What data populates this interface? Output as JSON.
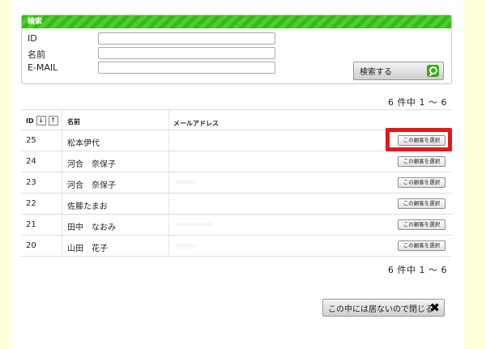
{
  "search": {
    "header": "検索",
    "fields": [
      {
        "label": "ID",
        "value": ""
      },
      {
        "label": "名前",
        "value": ""
      },
      {
        "label": "E-MAIL",
        "value": ""
      }
    ],
    "button_label": "検索する",
    "button_icon": "search-icon"
  },
  "result_count": "6 件中 1 〜 6",
  "table": {
    "headers": {
      "id": "ID",
      "name": "名前",
      "email": "メールアドレス"
    },
    "sort_asc": "↓",
    "sort_desc": "↑",
    "select_label": "この顧客を選択",
    "rows": [
      {
        "id": "25",
        "name": "松本伊代",
        "email": ""
      },
      {
        "id": "24",
        "name": "河合　奈保子",
        "email": ""
      },
      {
        "id": "23",
        "name": "河合　奈保子",
        "email": "··········"
      },
      {
        "id": "22",
        "name": "佐藤たまお",
        "email": ""
      },
      {
        "id": "21",
        "name": "田中　なおみ",
        "email": "··················"
      },
      {
        "id": "20",
        "name": "山田　花子",
        "email": "··········"
      }
    ],
    "highlight_color": "#e41818"
  },
  "close_button": {
    "label": "この中には居ないので閉じる",
    "icon": "close-icon"
  }
}
